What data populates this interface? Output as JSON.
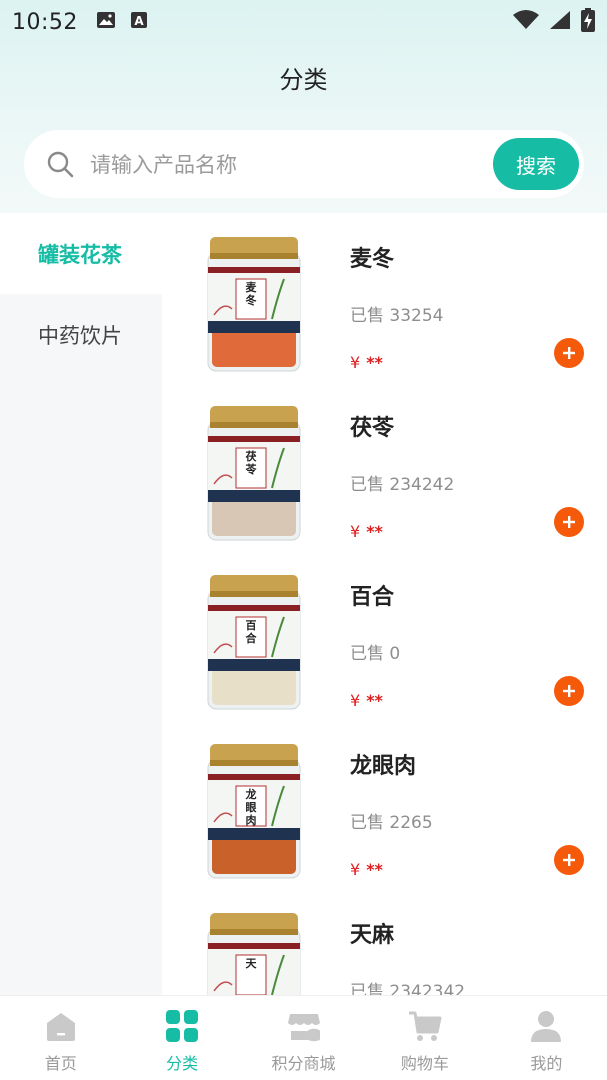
{
  "status_bar": {
    "time": "10:52"
  },
  "header": {
    "title": "分类"
  },
  "search": {
    "placeholder": "请输入产品名称",
    "button_label": "搜索"
  },
  "sidebar": {
    "items": [
      {
        "label": "罐装花茶",
        "active": true
      },
      {
        "label": "中药饮片",
        "active": false
      }
    ]
  },
  "products": [
    {
      "name": "麦冬",
      "sold": "已售 33254",
      "currency": "¥",
      "price": "**",
      "jar_label": "麦冬",
      "contents_color": "#e06a3a"
    },
    {
      "name": "茯苓",
      "sold": "已售 234242",
      "currency": "¥",
      "price": "**",
      "jar_label": "茯苓",
      "contents_color": "#d9c7b5"
    },
    {
      "name": "百合",
      "sold": "已售 0",
      "currency": "¥",
      "price": "**",
      "jar_label": "百合",
      "contents_color": "#e8dfc8"
    },
    {
      "name": "龙眼肉",
      "sold": "已售 2265",
      "currency": "¥",
      "price": "**",
      "jar_label": "龙眼肉",
      "contents_color": "#c8622a"
    },
    {
      "name": "天麻",
      "sold": "已售 2342342",
      "currency": "¥",
      "price": "**",
      "jar_label": "天",
      "contents_color": "#d8c6a0"
    }
  ],
  "tab_bar": {
    "items": [
      {
        "label": "首页",
        "icon": "home-icon",
        "active": false
      },
      {
        "label": "分类",
        "icon": "category-icon",
        "active": true
      },
      {
        "label": "积分商城",
        "icon": "points-mall-icon",
        "active": false
      },
      {
        "label": "购物车",
        "icon": "cart-icon",
        "active": false
      },
      {
        "label": "我的",
        "icon": "profile-icon",
        "active": false
      }
    ]
  },
  "colors": {
    "accent": "#17bca5",
    "price": "#e02020",
    "add_button": "#f55a0a",
    "inactive_tab": "#9a9a9a"
  }
}
